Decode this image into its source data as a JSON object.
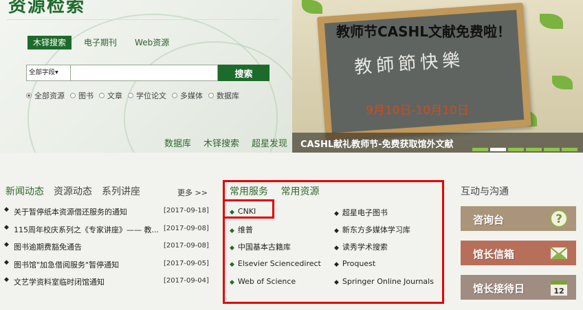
{
  "search": {
    "site_title": "资源检索",
    "tabs": [
      {
        "label": "木铎搜索",
        "active": true
      },
      {
        "label": "电子期刊",
        "active": false
      },
      {
        "label": "Web资源",
        "active": false
      }
    ],
    "field_select": "全部字段",
    "button_label": "搜索",
    "radios": [
      {
        "label": "全部资源",
        "checked": true
      },
      {
        "label": "图书",
        "checked": false
      },
      {
        "label": "文章",
        "checked": false
      },
      {
        "label": "学位论文",
        "checked": false
      },
      {
        "label": "多媒体",
        "checked": false
      },
      {
        "label": "数据库",
        "checked": false
      }
    ],
    "quick_links": [
      "数据库",
      "木铎搜索",
      "超星发现"
    ]
  },
  "banner": {
    "headline": "教师节CASHL文献免费啦！",
    "chalk_text": "教師節快樂",
    "date_range": "9月10日-10月10日",
    "caption": "CASHL献礼教师节-免费获取馆外文献",
    "slide_count": 6,
    "current_slide": 2
  },
  "news": {
    "tabs": [
      "新闻动态",
      "资源动态",
      "系列讲座"
    ],
    "more_label": "更多 >>",
    "items": [
      {
        "title": "关于暂停纸本资源借还服务的通知",
        "date": "[2017-09-18]"
      },
      {
        "title": "115周年校庆系列之《专家讲座》—— 教...",
        "date": "[2017-09-08]"
      },
      {
        "title": "图书逾期费豁免通告",
        "date": "[2017-09-08]"
      },
      {
        "title": "图书馆\"加急借阅服务\"暂停通知",
        "date": "[2017-09-05]"
      },
      {
        "title": "文艺学资料室临时闭馆通知",
        "date": "[2017-09-04]"
      }
    ]
  },
  "services": {
    "tabs": [
      "常用服务",
      "常用资源"
    ],
    "left": [
      "CNKI",
      "维普",
      "中国基本古籍库",
      "Elsevier Sciencedirect",
      "Web of Science"
    ],
    "right": [
      "超星电子图书",
      "新东方多媒体学习库",
      "读秀学术搜索",
      "Proquest",
      "Springer Online Journals"
    ]
  },
  "interact": {
    "title": "互动与沟通",
    "buttons": [
      {
        "label": "咨询台",
        "icon": "question-icon"
      },
      {
        "label": "馆长信箱",
        "icon": "envelope-icon"
      },
      {
        "label": "馆长接待日",
        "icon": "calendar-icon",
        "calendar_day": "12"
      }
    ]
  }
}
